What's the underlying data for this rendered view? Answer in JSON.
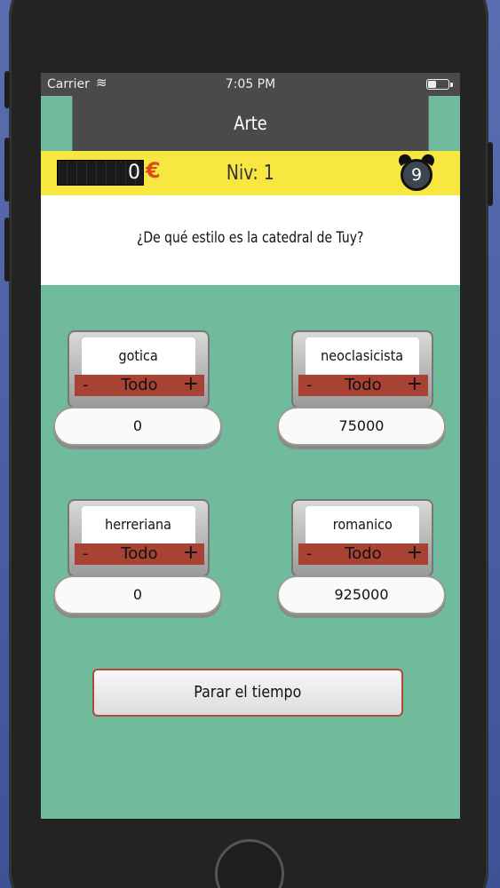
{
  "status": {
    "carrier": "Carrier",
    "time": "7:05 PM"
  },
  "nav": {
    "title": "Arte"
  },
  "info": {
    "money": "0",
    "currency": "€",
    "level": "Niv: 1",
    "timer": "9"
  },
  "question": "¿De qué estilo es la catedral de Tuy?",
  "answers": [
    {
      "label": "gotica",
      "minus": "-",
      "todo": "Todo",
      "plus": "+",
      "value": "0"
    },
    {
      "label": "neoclasicista",
      "minus": "-",
      "todo": "Todo",
      "plus": "+",
      "value": "75000"
    },
    {
      "label": "herreriana",
      "minus": "-",
      "todo": "Todo",
      "plus": "+",
      "value": "0"
    },
    {
      "label": "romanico",
      "minus": "-",
      "todo": "Todo",
      "plus": "+",
      "value": "925000"
    }
  ],
  "stop_button": "Parar el tiempo",
  "colors": {
    "accent_yellow": "#f8e641",
    "background_green": "#6fbb9b",
    "bar_red": "#a84234"
  }
}
